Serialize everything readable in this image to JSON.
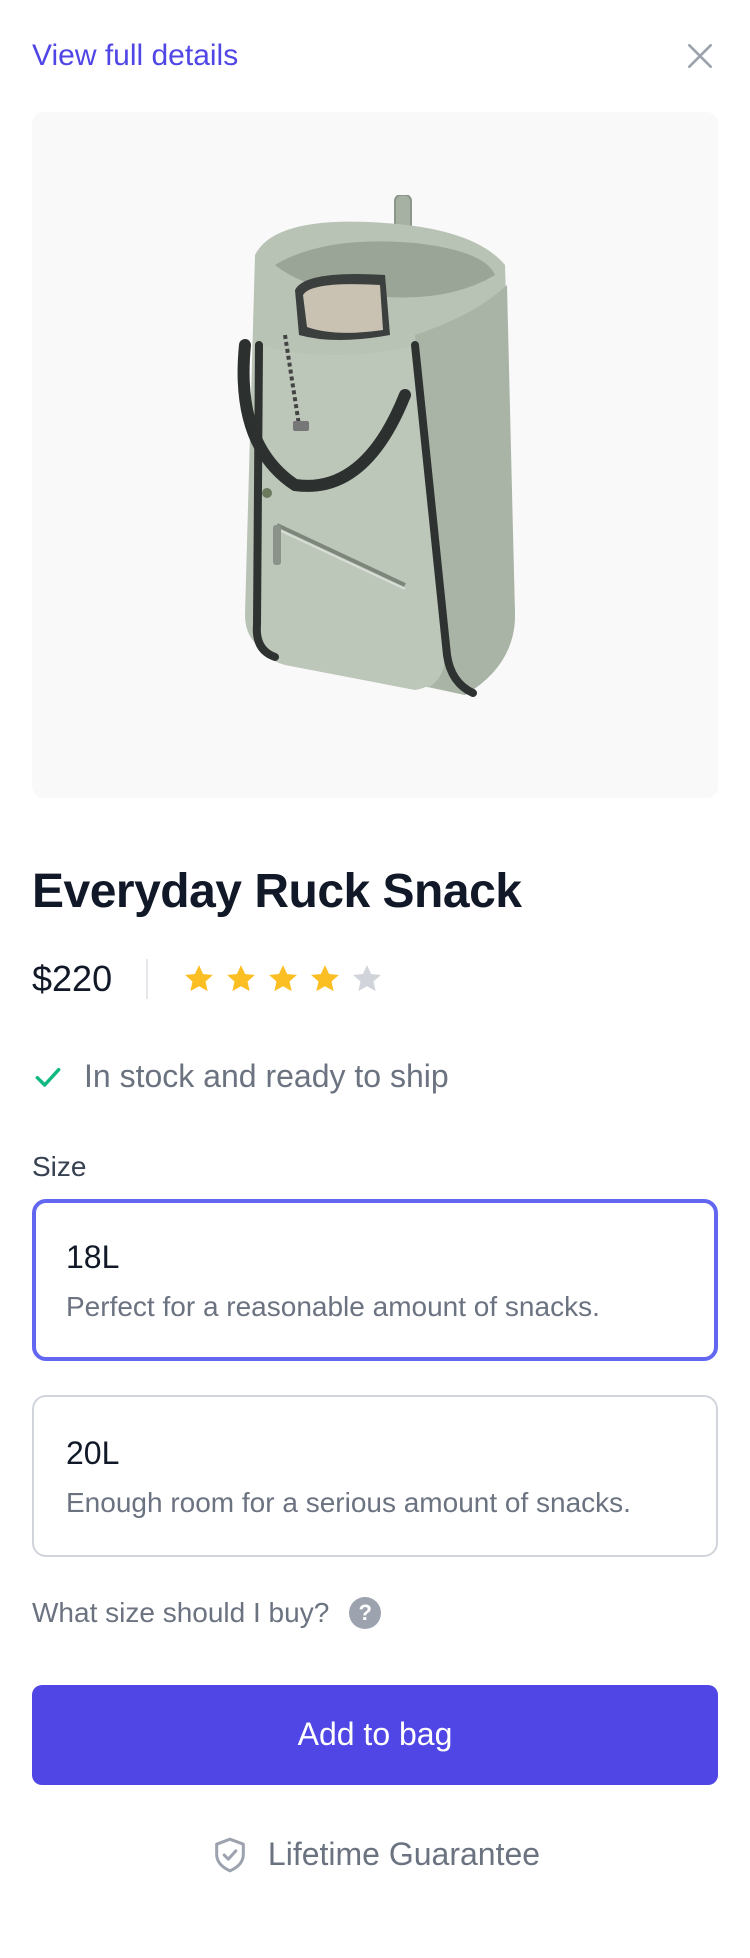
{
  "header": {
    "view_details_label": "View full details",
    "close_icon": "close-icon"
  },
  "product": {
    "image_alt": "Everyday Ruck Snack bag",
    "title": "Everyday Ruck Snack",
    "price": "$220",
    "rating": 4,
    "rating_max": 5,
    "stock_text": "In stock and ready to ship"
  },
  "size": {
    "label": "Size",
    "options": [
      {
        "name": "18L",
        "description": "Perfect for a reasonable amount of snacks.",
        "selected": true
      },
      {
        "name": "20L",
        "description": "Enough room for a serious amount of snacks.",
        "selected": false
      }
    ],
    "help_text": "What size should I buy?",
    "help_icon_glyph": "?"
  },
  "actions": {
    "add_to_bag_label": "Add to bag"
  },
  "guarantee": {
    "label": "Lifetime Guarantee"
  },
  "colors": {
    "accent": "#4f46e5",
    "selected_border": "#6366f1",
    "star_filled": "#fbbf24",
    "star_empty": "#d1d5db",
    "check": "#10b981"
  }
}
